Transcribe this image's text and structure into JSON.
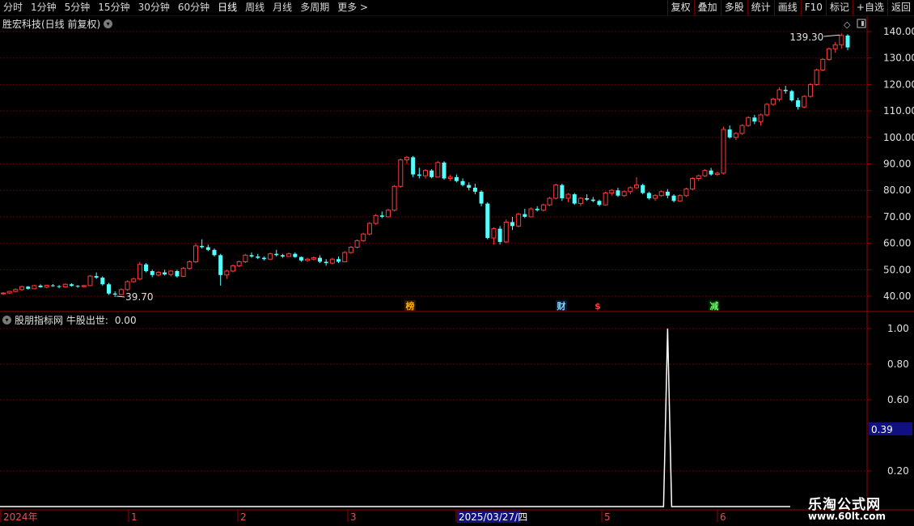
{
  "toolbar": {
    "periods": [
      "分时",
      "1分钟",
      "5分钟",
      "15分钟",
      "30分钟",
      "60分钟",
      "日线",
      "周线",
      "月线",
      "多周期",
      "更多 >"
    ],
    "active_period": "日线",
    "buttons": [
      "复权",
      "叠加",
      "多股",
      "统计",
      "画线",
      "F10",
      "标记",
      "+自选",
      "返回"
    ]
  },
  "stock_title": "胜宏科技(日线 前复权)",
  "indicator": {
    "name": "股朋指标网 牛股出世:",
    "value": "0.00"
  },
  "price_axis": [
    "140.00",
    "130.00",
    "120.00",
    "110.00",
    "100.00",
    "90.00",
    "80.00",
    "70.00",
    "60.00",
    "50.00",
    "40.00"
  ],
  "ind_axis": [
    "1.00",
    "0.80",
    "0.60",
    "0.20"
  ],
  "ind_cursor": "0.39",
  "annotations": {
    "high": "139.30",
    "low": "39.70"
  },
  "markers": [
    "榜",
    "财",
    "$",
    "减"
  ],
  "date_axis": [
    "2024年",
    "1",
    "2",
    "3",
    "2025/03/27/四",
    "5",
    "6"
  ],
  "colors": {
    "up": "#ff3b3b",
    "down": "#54ffff",
    "grid": "#7a0000",
    "axis": "#a00000"
  },
  "watermark": {
    "line1": "乐淘公式网",
    "line2": "www.60lt.com"
  },
  "chart_data": {
    "type": "candlestick",
    "title": "胜宏科技(日线 前复权)",
    "ylim": [
      35,
      145
    ],
    "candles": [
      [
        41.0,
        41.5,
        40.5,
        41.2
      ],
      [
        41.2,
        42.0,
        40.8,
        41.8
      ],
      [
        41.8,
        43.0,
        41.5,
        42.5
      ],
      [
        42.5,
        44.0,
        42.0,
        43.6
      ],
      [
        43.6,
        43.8,
        42.5,
        42.8
      ],
      [
        42.8,
        44.2,
        42.6,
        44.0
      ],
      [
        44.0,
        44.5,
        43.2,
        43.4
      ],
      [
        43.4,
        44.3,
        43.0,
        44.1
      ],
      [
        44.1,
        44.6,
        43.5,
        43.8
      ],
      [
        43.8,
        44.2,
        43.0,
        43.5
      ],
      [
        43.5,
        44.8,
        43.2,
        44.5
      ],
      [
        44.5,
        44.9,
        43.6,
        43.9
      ],
      [
        43.9,
        44.2,
        43.2,
        43.6
      ],
      [
        43.6,
        44.3,
        43.4,
        44.0
      ],
      [
        44.0,
        48.0,
        43.8,
        47.6
      ],
      [
        47.6,
        49.0,
        46.5,
        47.0
      ],
      [
        47.0,
        47.5,
        44.0,
        44.5
      ],
      [
        44.5,
        45.0,
        40.5,
        41.0
      ],
      [
        41.0,
        41.8,
        39.7,
        40.6
      ],
      [
        40.6,
        43.0,
        40.4,
        42.5
      ],
      [
        42.5,
        46.0,
        42.0,
        45.5
      ],
      [
        45.5,
        47.0,
        45.0,
        46.5
      ],
      [
        46.5,
        53.0,
        46.0,
        52.0
      ],
      [
        52.0,
        52.5,
        49.0,
        49.5
      ],
      [
        49.5,
        50.0,
        47.2,
        48.0
      ],
      [
        48.0,
        49.5,
        47.5,
        49.0
      ],
      [
        49.0,
        50.0,
        47.8,
        48.2
      ],
      [
        48.2,
        49.8,
        47.5,
        49.5
      ],
      [
        49.5,
        50.0,
        47.0,
        47.5
      ],
      [
        47.5,
        51.0,
        47.2,
        50.5
      ],
      [
        50.5,
        53.5,
        50.0,
        53.0
      ],
      [
        53.0,
        60.0,
        52.5,
        59.0
      ],
      [
        59.0,
        61.5,
        58.0,
        58.5
      ],
      [
        58.5,
        59.5,
        57.0,
        57.5
      ],
      [
        57.5,
        58.0,
        55.0,
        55.5
      ],
      [
        55.5,
        56.0,
        44.0,
        48.0
      ],
      [
        48.0,
        50.0,
        46.5,
        49.5
      ],
      [
        49.5,
        52.0,
        49.0,
        51.5
      ],
      [
        51.5,
        53.5,
        51.0,
        53.0
      ],
      [
        53.0,
        56.0,
        52.5,
        55.5
      ],
      [
        55.5,
        56.5,
        54.5,
        55.0
      ],
      [
        55.0,
        56.0,
        54.0,
        54.5
      ],
      [
        54.5,
        55.0,
        53.5,
        54.0
      ],
      [
        54.0,
        56.5,
        53.8,
        56.0
      ],
      [
        56.0,
        57.5,
        55.0,
        55.5
      ],
      [
        55.5,
        56.0,
        54.5,
        55.0
      ],
      [
        55.0,
        56.5,
        54.8,
        56.0
      ],
      [
        56.0,
        56.5,
        54.5,
        54.8
      ],
      [
        54.8,
        55.0,
        53.0,
        53.5
      ],
      [
        53.5,
        54.5,
        53.0,
        54.0
      ],
      [
        54.0,
        55.0,
        53.5,
        54.5
      ],
      [
        54.5,
        55.5,
        52.5,
        53.0
      ],
      [
        53.0,
        54.0,
        51.5,
        52.5
      ],
      [
        52.5,
        54.5,
        52.0,
        54.0
      ],
      [
        54.0,
        55.0,
        52.5,
        53.0
      ],
      [
        53.0,
        57.0,
        52.8,
        56.5
      ],
      [
        56.5,
        59.0,
        56.0,
        58.5
      ],
      [
        58.5,
        61.5,
        58.0,
        61.0
      ],
      [
        61.0,
        64.0,
        60.5,
        63.5
      ],
      [
        63.5,
        68.0,
        63.0,
        67.5
      ],
      [
        67.5,
        71.0,
        67.0,
        70.5
      ],
      [
        70.5,
        72.0,
        69.5,
        70.0
      ],
      [
        70.0,
        73.0,
        69.8,
        72.5
      ],
      [
        72.5,
        82.0,
        72.0,
        81.5
      ],
      [
        81.5,
        92.0,
        81.0,
        91.5
      ],
      [
        91.5,
        93.0,
        90.0,
        92.5
      ],
      [
        92.5,
        93.0,
        85.0,
        86.0
      ],
      [
        86.0,
        88.5,
        84.5,
        85.5
      ],
      [
        85.5,
        88.0,
        84.5,
        87.5
      ],
      [
        87.5,
        88.0,
        84.5,
        85.0
      ],
      [
        85.0,
        91.0,
        84.8,
        90.5
      ],
      [
        90.5,
        91.0,
        84.0,
        84.5
      ],
      [
        84.5,
        86.0,
        83.5,
        85.0
      ],
      [
        85.0,
        86.0,
        83.0,
        83.5
      ],
      [
        83.5,
        84.5,
        81.5,
        82.0
      ],
      [
        82.0,
        83.0,
        80.0,
        81.0
      ],
      [
        81.0,
        82.5,
        78.5,
        79.5
      ],
      [
        79.5,
        80.0,
        74.0,
        75.0
      ],
      [
        75.0,
        75.5,
        61.5,
        62.0
      ],
      [
        62.0,
        66.0,
        59.5,
        65.5
      ],
      [
        65.5,
        66.5,
        59.5,
        60.5
      ],
      [
        60.5,
        69.0,
        60.0,
        68.0
      ],
      [
        68.0,
        70.0,
        65.0,
        66.5
      ],
      [
        66.5,
        71.5,
        66.0,
        71.0
      ],
      [
        71.0,
        73.0,
        69.5,
        70.0
      ],
      [
        70.0,
        73.5,
        69.8,
        73.0
      ],
      [
        73.0,
        74.0,
        72.0,
        72.5
      ],
      [
        72.5,
        75.0,
        72.0,
        74.5
      ],
      [
        74.5,
        77.5,
        74.0,
        77.0
      ],
      [
        77.0,
        82.5,
        76.5,
        82.0
      ],
      [
        82.0,
        82.5,
        76.0,
        77.0
      ],
      [
        77.0,
        79.0,
        75.5,
        78.5
      ],
      [
        78.5,
        79.0,
        74.5,
        75.0
      ],
      [
        75.0,
        77.5,
        74.0,
        77.0
      ],
      [
        77.0,
        78.5,
        76.0,
        76.5
      ],
      [
        76.5,
        77.5,
        75.5,
        76.0
      ],
      [
        76.0,
        76.5,
        74.0,
        74.5
      ],
      [
        74.5,
        79.5,
        74.2,
        79.0
      ],
      [
        79.0,
        80.5,
        78.0,
        80.0
      ],
      [
        80.0,
        81.0,
        77.5,
        78.0
      ],
      [
        78.0,
        80.0,
        77.5,
        79.5
      ],
      [
        79.5,
        81.5,
        78.5,
        81.0
      ],
      [
        81.0,
        85.0,
        80.5,
        82.0
      ],
      [
        82.0,
        82.5,
        78.5,
        79.0
      ],
      [
        79.0,
        79.5,
        76.5,
        77.0
      ],
      [
        77.0,
        78.5,
        76.0,
        78.0
      ],
      [
        78.0,
        80.0,
        77.5,
        79.5
      ],
      [
        79.5,
        80.5,
        77.0,
        78.0
      ],
      [
        78.0,
        78.5,
        75.5,
        76.0
      ],
      [
        76.0,
        78.5,
        75.8,
        78.0
      ],
      [
        78.0,
        81.0,
        77.5,
        80.5
      ],
      [
        80.5,
        85.0,
        80.0,
        84.5
      ],
      [
        84.5,
        86.0,
        83.5,
        85.5
      ],
      [
        85.5,
        88.0,
        85.0,
        87.5
      ],
      [
        87.5,
        88.5,
        85.5,
        86.0
      ],
      [
        86.0,
        87.0,
        85.5,
        86.5
      ],
      [
        86.5,
        104.0,
        86.0,
        103.0
      ],
      [
        103.0,
        104.5,
        99.5,
        100.0
      ],
      [
        100.0,
        102.0,
        99.0,
        101.5
      ],
      [
        101.5,
        105.0,
        101.0,
        104.5
      ],
      [
        104.5,
        108.0,
        104.0,
        107.5
      ],
      [
        107.5,
        108.5,
        105.0,
        106.0
      ],
      [
        106.0,
        109.0,
        104.5,
        108.5
      ],
      [
        108.5,
        113.0,
        108.0,
        112.5
      ],
      [
        112.5,
        115.0,
        112.0,
        114.5
      ],
      [
        114.5,
        119.0,
        113.5,
        118.0
      ],
      [
        118.0,
        119.5,
        116.5,
        117.5
      ],
      [
        117.5,
        118.0,
        113.5,
        114.0
      ],
      [
        114.0,
        115.0,
        110.5,
        111.5
      ],
      [
        111.5,
        116.0,
        111.0,
        115.5
      ],
      [
        115.5,
        120.5,
        115.0,
        120.0
      ],
      [
        120.0,
        126.0,
        119.5,
        125.5
      ],
      [
        125.5,
        130.0,
        125.0,
        129.5
      ],
      [
        129.5,
        134.0,
        129.0,
        133.5
      ],
      [
        133.5,
        136.0,
        132.0,
        135.0
      ],
      [
        135.0,
        139.3,
        133.5,
        138.5
      ],
      [
        138.5,
        139.0,
        133.0,
        134.0
      ]
    ],
    "indicator_series": {
      "name": "牛股出世",
      "ylim": [
        0.1,
        1.05
      ],
      "spike_candle_index": 107,
      "spike_value": 1.0,
      "base_value": 0.0
    }
  }
}
